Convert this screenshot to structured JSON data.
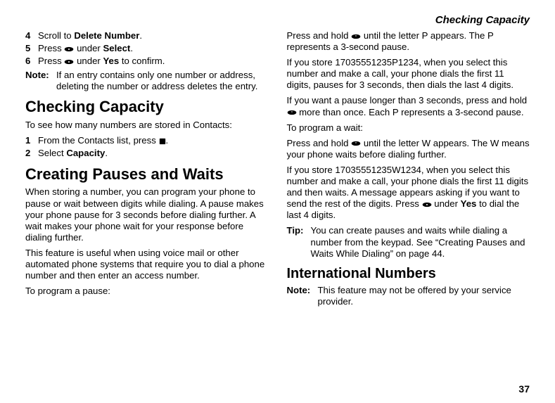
{
  "header": "Checking Capacity",
  "footer": "37",
  "labels": {
    "note": "Note:",
    "tip": "Tip:"
  },
  "left": {
    "steps1": [
      {
        "n": "4",
        "a": "Scroll to",
        "b": "Delete Number",
        "c": "."
      },
      {
        "n": "5",
        "a": "Press",
        "c": "under",
        "d": "Select",
        "e": "."
      },
      {
        "n": "6",
        "a": "Press",
        "c": "under",
        "d": "Yes",
        "e": "to confirm."
      }
    ],
    "note1": "If an entry contains only one number or address, deleting the number or address deletes the entry.",
    "h1": "Checking Capacity",
    "p1": "To see how many numbers are stored in Contacts:",
    "steps2": [
      {
        "n": "1",
        "a": "From the Contacts list, press",
        "c": "."
      },
      {
        "n": "2",
        "a": "Select",
        "b": "Capacity",
        "c": "."
      }
    ],
    "h2": "Creating Pauses and Waits",
    "p2": "When storing a number, you can program your phone to pause or wait between digits while dialing. A pause makes your phone pause for 3 seconds before dialing further. A wait makes your phone wait for your response before dialing further.",
    "p3": "This feature is useful when using voice mail or other automated phone systems that require you to dial a phone number and then enter an access number.",
    "p4": "To program a pause:",
    "indent1a": "Press and hold",
    "indent1b": "until the letter P appears. The P represents a 3-second pause."
  },
  "right": {
    "p1": "If you store 17035551235P1234, when you select this number and make a call, your phone dials the first 11 digits, pauses for 3 seconds, then dials the last 4 digits.",
    "p2a": "If you want a pause longer than 3 seconds, press and hold",
    "p2b": "more than once. Each P represents a 3-second pause.",
    "p3": "To program a wait:",
    "indent1a": "Press and hold",
    "indent1b": "until the letter W appears. The W means your phone waits before dialing further.",
    "p4a": "If you store 17035551235W1234, when you select this number and make a call, your phone dials the first 11 digits and then waits. A message appears asking if you want to send the rest of the digits. Press",
    "p4b": "under",
    "p4c": "Yes",
    "p4d": "to dial the last 4 digits.",
    "tip": "You can create pauses and waits while dialing a number from the keypad. See “Creating Pauses and Waits While Dialing” on page 44.",
    "h1": "International Numbers",
    "note1": "This feature may not be offered by your service provider."
  }
}
